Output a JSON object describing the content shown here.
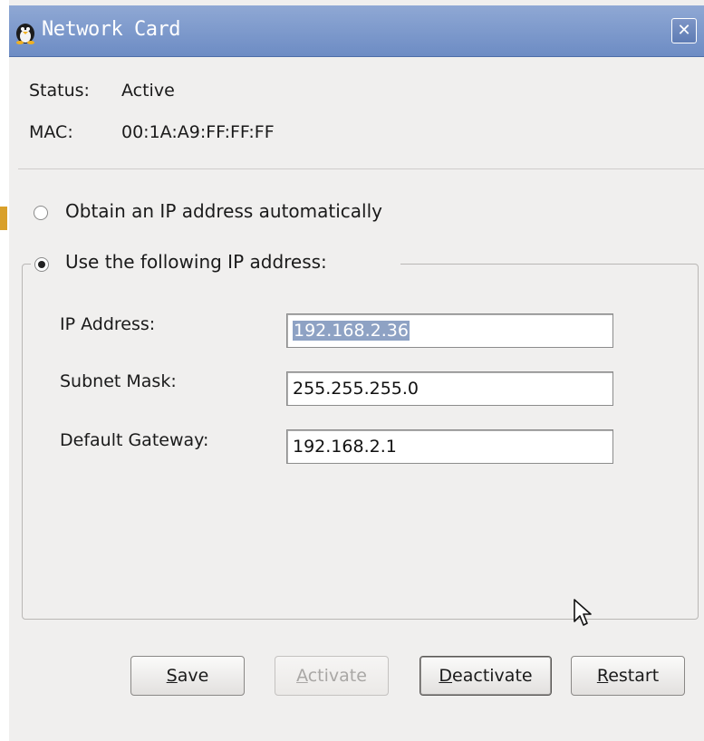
{
  "window": {
    "title": "Network Card",
    "close_glyph": "✕"
  },
  "info": {
    "status_label": "Status:",
    "status_value": "Active",
    "mac_label": "MAC:",
    "mac_value": "00:1A:A9:FF:FF:FF"
  },
  "ip_mode": {
    "auto_label": "Obtain an IP address automatically",
    "auto_selected": false,
    "manual_label": "Use the following IP address:",
    "manual_selected": true
  },
  "fields": {
    "ip_label": "IP Address:",
    "ip_value": "192.168.2.36",
    "subnet_label": "Subnet Mask:",
    "subnet_value": "255.255.255.0",
    "gateway_label": "Default Gateway:",
    "gateway_value": "192.168.2.1"
  },
  "buttons": {
    "save_mn": "S",
    "save_rest": "ave",
    "activate_mn": "A",
    "activate_rest": "ctivate",
    "activate_enabled": false,
    "deactivate_mn": "D",
    "deactivate_rest": "eactivate",
    "restart_mn": "R",
    "restart_rest": "estart"
  },
  "colors": {
    "titlebar": "#7d95c6",
    "selection": "#8ea2c4",
    "window_bg": "#f0efee"
  },
  "icons": {
    "title": "linux-penguin-icon",
    "close": "close-icon",
    "cursor": "mouse-pointer-icon"
  }
}
